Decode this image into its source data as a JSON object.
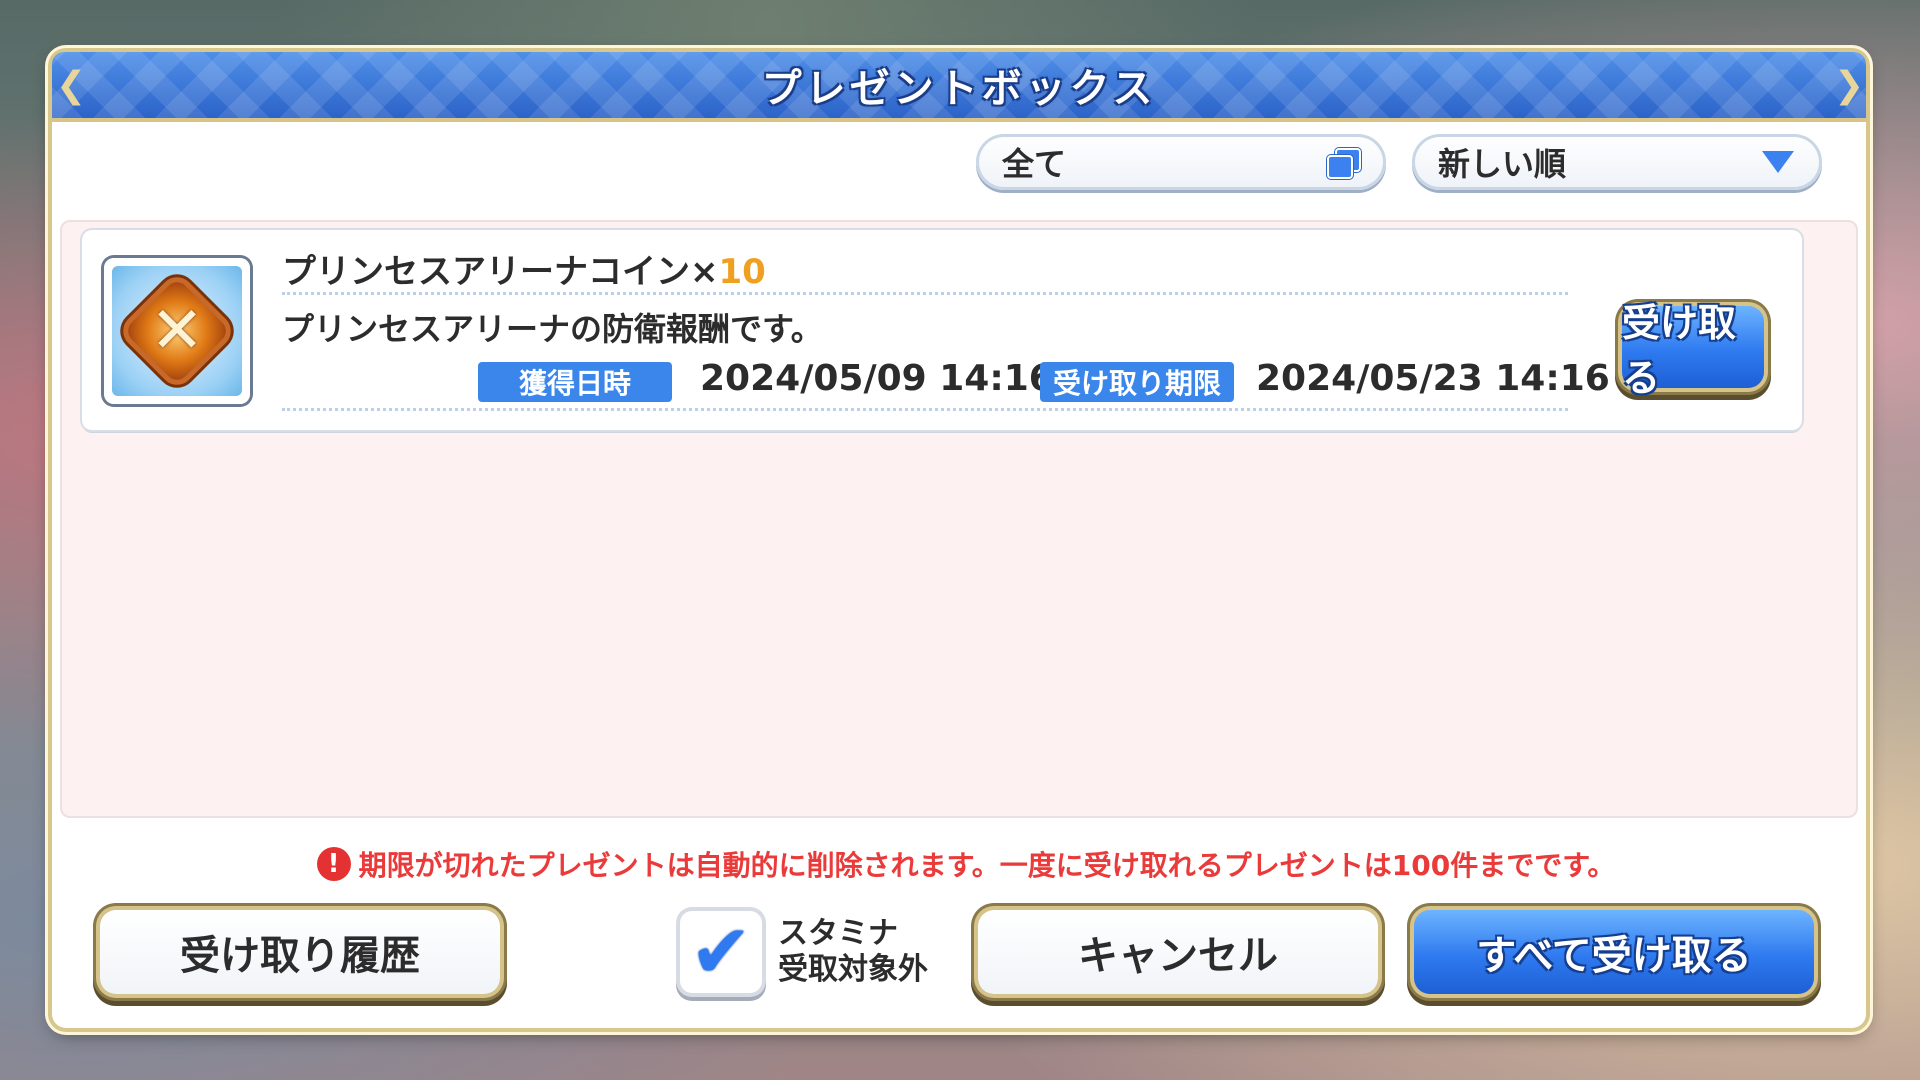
{
  "dialog": {
    "title": "プレゼントボックス"
  },
  "filter": {
    "label": "全て",
    "icon": "stack-icon"
  },
  "sort": {
    "label": "新しい順",
    "icon": "triangle-down-icon"
  },
  "items": [
    {
      "name": "プリンセスアリーナコイン×",
      "quantity": "10",
      "description": "プリンセスアリーナの防衛報酬です。",
      "acquired_label": "獲得日時",
      "acquired_date": "2024/05/09 14:16",
      "deadline_label": "受け取り期限",
      "deadline_date": "2024/05/23 14:16",
      "receive_label": "受け取る",
      "icon": "arena-coin-icon"
    }
  ],
  "warning": {
    "icon": "exclamation-icon",
    "text": "期限が切れたプレゼントは自動的に削除されます。一度に受け取れるプレゼントは100件までです。"
  },
  "footer": {
    "history_label": "受け取り履歴",
    "stamina_line1": "スタミナ",
    "stamina_line2": "受取対象外",
    "stamina_checked": true,
    "cancel_label": "キャンセル",
    "receive_all_label": "すべて受け取る"
  },
  "colors": {
    "accent_blue": "#2f7af0",
    "header_blue": "#2c63c9",
    "quantity_orange": "#f0a020",
    "warning_red": "#ea3a3a",
    "gold_border": "#d6c38a"
  }
}
